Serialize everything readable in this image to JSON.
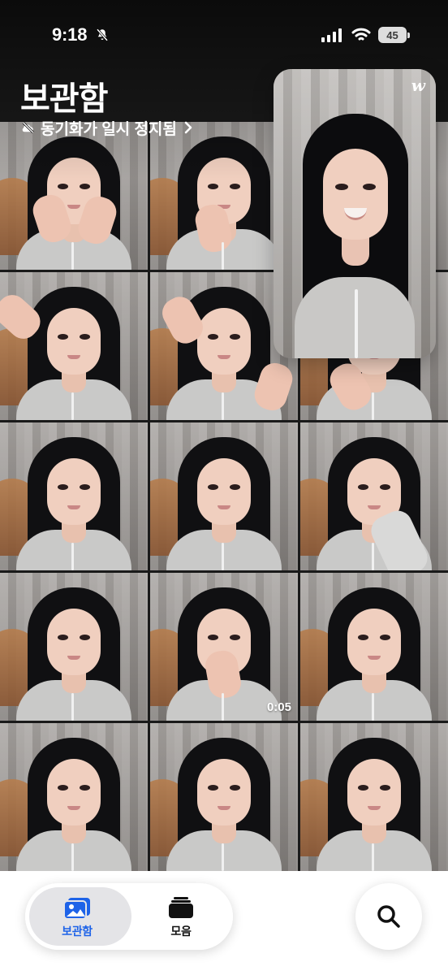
{
  "status_bar": {
    "time": "9:18",
    "battery": "45"
  },
  "header": {
    "title": "보관함",
    "sync_status": "동기화가 일시 정지됨"
  },
  "grid": {
    "video_duration": "0:05"
  },
  "pip": {
    "logo": "w"
  },
  "bottom_tabs": [
    {
      "label": "보관함",
      "icon": "photo-library-icon"
    },
    {
      "label": "모음",
      "icon": "stacked-collections-icon"
    }
  ],
  "search": {
    "icon": "search-icon"
  },
  "colors": {
    "accent": "#1e63e8",
    "tab_active_bg": "#e4e4e7",
    "bar_bg": "#ffffff"
  }
}
